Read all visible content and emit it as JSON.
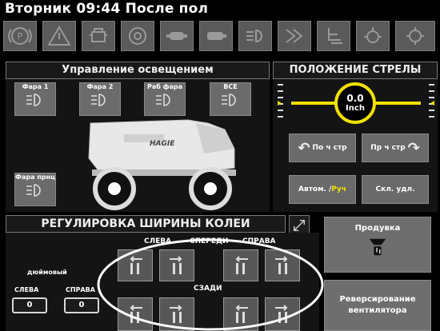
{
  "header": {
    "title": "Вторник 09:44 После пол"
  },
  "toolbar": {
    "icons": [
      "parking-brake-icon",
      "warning-triangle-icon",
      "engine-warning-icon",
      "fan-icon",
      "transmission-icon",
      "hydraulic-icon",
      "lights-icon",
      "steering-icon",
      "seat-icon",
      "hitch-icon",
      "gear-icon"
    ]
  },
  "lighting": {
    "title": "Управление освещением",
    "buttons": [
      {
        "label": "Фара 1"
      },
      {
        "label": "Фара 2"
      },
      {
        "label": "Раб фара"
      },
      {
        "label": "ВСЕ"
      }
    ],
    "trailer_light": "Фара прнц"
  },
  "boom": {
    "title": "ПОЛОЖЕНИЕ СТРЕЛЫ",
    "value": "0.0",
    "unit": "Inch",
    "buttons": {
      "left": "По ч стр",
      "right": "Пр ч стр",
      "auto_part1": "Автом. / ",
      "auto_part2": "Руч",
      "fold": "Скл. удл."
    }
  },
  "track": {
    "title": "РЕГУЛИРОВКА ШИРИНЫ КОЛЕИ",
    "left_label": "СЛЕВА",
    "front_label": "СПЕРЕДИ",
    "right_label": "СПРАВА",
    "rear_label": "СЗАДИ",
    "inch_label": "дюймовый",
    "value_left_label": "СЛЕВА",
    "value_right_label": "СПРАВА",
    "value_left": "0",
    "value_right": "0"
  },
  "actions": {
    "blowout": "Продувка",
    "reverse_fan": "Реверсирование вентилятора"
  },
  "colors": {
    "accent": "#f0e000",
    "button": "#6b6b6b"
  }
}
